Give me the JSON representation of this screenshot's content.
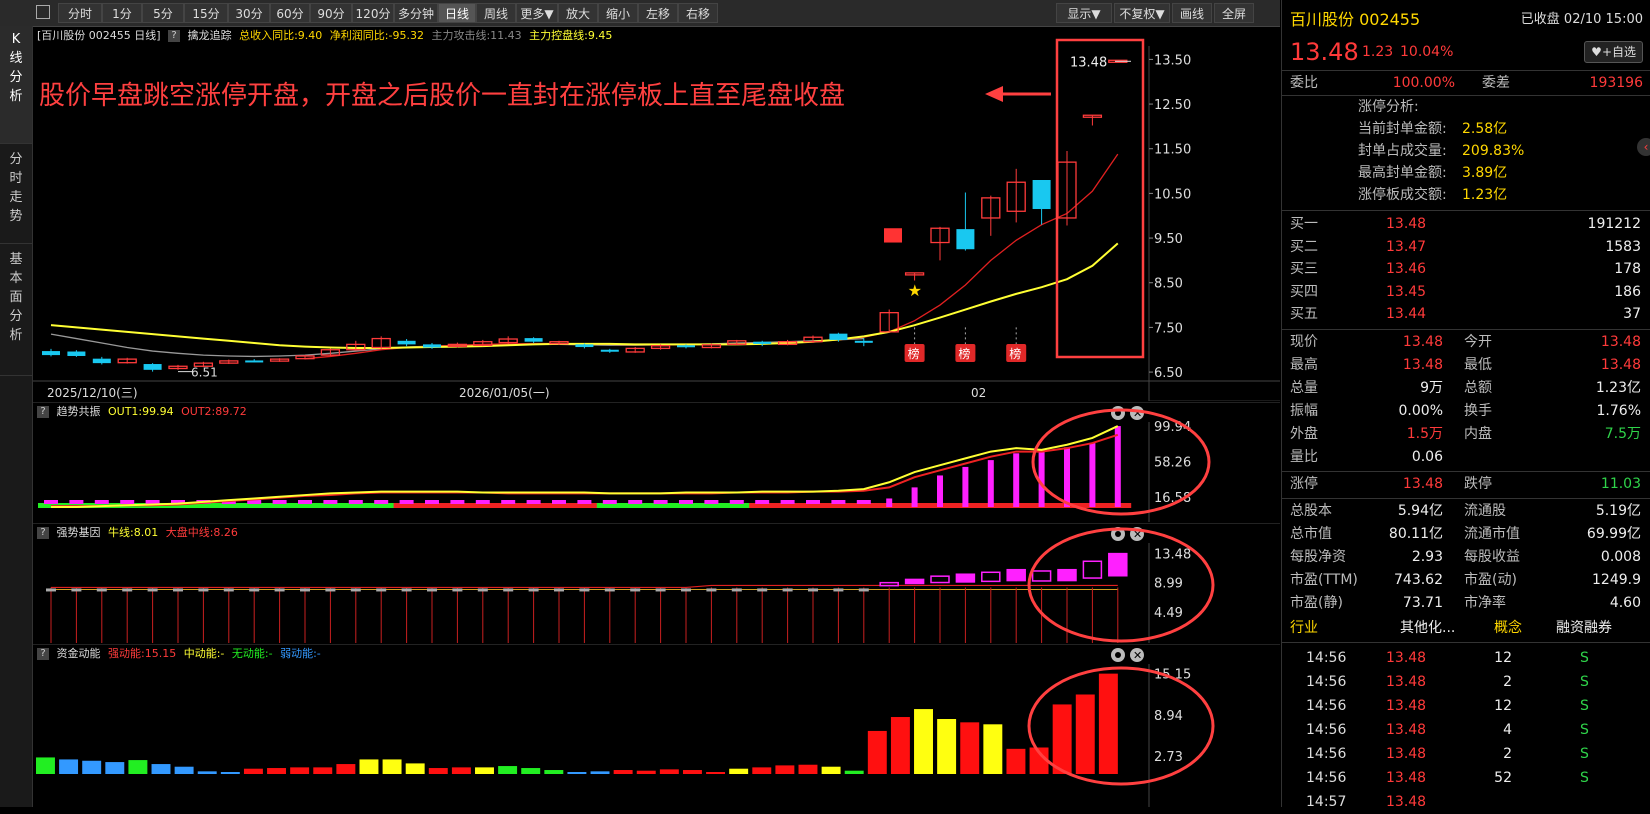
{
  "toolbar": {
    "left_items": [
      "分时",
      "1分",
      "5分",
      "15分",
      "30分",
      "60分",
      "90分",
      "120分",
      "多分钟",
      "日线",
      "周线",
      "更多▼",
      "放大",
      "缩小",
      "左移",
      "右移"
    ],
    "active_index": 9,
    "right_items": [
      "显示▼",
      "不复权▼",
      "画线",
      "全屏"
    ]
  },
  "sidetabs": [
    {
      "label": [
        "K",
        "线",
        "分",
        "析"
      ]
    },
    {
      "label": [
        "分",
        "时",
        "走",
        "势"
      ]
    },
    {
      "label": [
        "基",
        "本",
        "面",
        "分",
        "析"
      ]
    }
  ],
  "main_header": {
    "stock": "[百川股份 002455 日线]",
    "indicator": "擒龙追踪",
    "income": "总收入同比:9.40",
    "profit": "净利润同比:-95.32",
    "attack": "主力攻击线:11.43",
    "control": "主力控盘线:9.45"
  },
  "annotation": "股价早盘跳空涨停开盘，开盘之后股价一直封在涨停板上直至尾盘收盘",
  "last_price_label": "13.48",
  "low_label": "6.51",
  "rank_badge": "榜",
  "colors": {
    "up": "#ff3b3b",
    "down": "#19c8f0",
    "ma1": "#ffff33",
    "ma2": "#e02020",
    "ma3": "#999999",
    "annot": "#ff4040",
    "magenta": "#ff20ff",
    "green": "#22ee22",
    "blue": "#3399ff"
  },
  "x_labels": [
    "2025/12/10(三)",
    "2026/01/05(一)",
    "02"
  ],
  "chart_data": [
    {
      "type": "candlestick",
      "title": "百川股份 002455 日线",
      "y_ticks": [
        "13.50",
        "12.50",
        "11.50",
        "10.50",
        "9.50",
        "8.50",
        "7.50",
        "6.50"
      ],
      "ylim": [
        6.3,
        13.8
      ],
      "candles": [
        [
          6.97,
          6.88,
          7.02,
          6.85
        ],
        [
          6.96,
          6.86,
          6.99,
          6.84
        ],
        [
          6.8,
          6.7,
          6.84,
          6.67
        ],
        [
          6.71,
          6.79,
          6.82,
          6.69
        ],
        [
          6.68,
          6.55,
          6.7,
          6.51
        ],
        [
          6.58,
          6.63,
          6.66,
          6.55
        ],
        [
          6.63,
          6.7,
          6.73,
          6.61
        ],
        [
          6.7,
          6.75,
          6.78,
          6.68
        ],
        [
          6.76,
          6.74,
          6.79,
          6.72
        ],
        [
          6.75,
          6.79,
          6.81,
          6.73
        ],
        [
          6.8,
          6.86,
          6.88,
          6.78
        ],
        [
          6.88,
          7.0,
          7.03,
          6.86
        ],
        [
          7.0,
          7.12,
          7.2,
          6.98
        ],
        [
          7.05,
          7.25,
          7.3,
          7.02
        ],
        [
          7.2,
          7.12,
          7.24,
          7.08
        ],
        [
          7.12,
          7.05,
          7.15,
          7.02
        ],
        [
          7.08,
          7.12,
          7.16,
          7.05
        ],
        [
          7.1,
          7.18,
          7.22,
          7.08
        ],
        [
          7.16,
          7.24,
          7.3,
          7.13
        ],
        [
          7.26,
          7.18,
          7.28,
          7.15
        ],
        [
          7.14,
          7.18,
          7.2,
          7.11
        ],
        [
          7.12,
          7.06,
          7.14,
          7.03
        ],
        [
          7.0,
          6.96,
          7.02,
          6.93
        ],
        [
          6.95,
          7.03,
          7.06,
          6.93
        ],
        [
          7.03,
          7.09,
          7.12,
          7.0
        ],
        [
          7.1,
          7.07,
          7.12,
          7.03
        ],
        [
          7.05,
          7.11,
          7.14,
          7.03
        ],
        [
          7.12,
          7.2,
          7.22,
          7.1
        ],
        [
          7.18,
          7.13,
          7.2,
          7.08
        ],
        [
          7.12,
          7.18,
          7.22,
          7.1
        ],
        [
          7.18,
          7.28,
          7.32,
          7.15
        ],
        [
          7.36,
          7.22,
          7.38,
          7.18
        ],
        [
          7.2,
          7.18,
          7.26,
          7.08
        ],
        [
          7.4,
          7.83,
          7.9,
          7.38
        ],
        [
          8.72,
          8.72,
          8.72,
          8.55
        ],
        [
          9.4,
          9.72,
          9.75,
          9.0
        ],
        [
          9.7,
          9.25,
          10.52,
          9.22
        ],
        [
          9.95,
          10.4,
          10.45,
          9.55
        ],
        [
          10.1,
          10.75,
          11.05,
          9.85
        ],
        [
          10.8,
          10.15,
          10.8,
          9.8
        ],
        [
          9.95,
          11.2,
          11.45,
          9.78
        ],
        [
          12.25,
          12.25,
          12.25,
          12.02
        ],
        [
          13.48,
          13.48,
          13.48,
          13.48
        ]
      ],
      "ma_yellow": [
        7.55,
        7.5,
        7.45,
        7.4,
        7.35,
        7.3,
        7.25,
        7.2,
        7.15,
        7.1,
        7.07,
        7.05,
        7.04,
        7.04,
        7.05,
        7.06,
        7.07,
        7.08,
        7.1,
        7.12,
        7.13,
        7.13,
        7.13,
        7.12,
        7.12,
        7.12,
        7.12,
        7.12,
        7.13,
        7.15,
        7.18,
        7.23,
        7.3,
        7.4,
        7.55,
        7.72,
        7.9,
        8.08,
        8.25,
        8.4,
        8.58,
        8.88,
        9.38
      ],
      "ma_red": [
        null,
        null,
        null,
        null,
        null,
        null,
        null,
        null,
        null,
        null,
        6.8,
        6.85,
        6.92,
        7.0,
        7.05,
        7.08,
        7.1,
        7.12,
        7.13,
        7.14,
        7.14,
        7.13,
        7.12,
        7.11,
        7.11,
        7.11,
        7.12,
        7.13,
        7.14,
        7.16,
        7.18,
        7.22,
        7.28,
        7.4,
        7.65,
        8.0,
        8.45,
        9.0,
        9.45,
        9.8,
        10.05,
        10.55,
        11.38
      ],
      "ma_grey": [
        7.35,
        7.25,
        7.15,
        7.05,
        6.97,
        6.92,
        6.88,
        6.86,
        6.85,
        6.86,
        6.88,
        6.92,
        6.97,
        7.02,
        7.06,
        7.08,
        7.1,
        7.11,
        7.12,
        7.13,
        7.12,
        7.11,
        7.1,
        7.1,
        7.11,
        7.12,
        7.13,
        7.15,
        7.16,
        7.18,
        7.2,
        7.22,
        7.25
      ]
    },
    {
      "type": "bar",
      "title": "趋势共振",
      "legend": [
        "OUT1:99.94",
        "OUT2:89.72"
      ],
      "y_ticks": [
        "99.94",
        "58.26",
        "16.58"
      ],
      "ylim": [
        5,
        100
      ],
      "bars": [
        0,
        0,
        0,
        0,
        0,
        0,
        0,
        0,
        0,
        0,
        0,
        0,
        0,
        0,
        0,
        0,
        0,
        0,
        0,
        0,
        0,
        0,
        0,
        0,
        0,
        0,
        0,
        0,
        0,
        0,
        0,
        0,
        0,
        15,
        28,
        42,
        52,
        60,
        68,
        72,
        75,
        80,
        99.94
      ],
      "bar_color_flag": [
        2,
        2,
        2,
        2,
        2,
        2,
        2,
        2,
        2,
        2,
        2,
        2,
        2,
        2,
        1,
        1,
        1,
        1,
        1,
        1,
        1,
        1,
        2,
        2,
        2,
        2,
        2,
        2,
        1,
        1,
        1,
        1,
        1,
        1,
        1,
        1,
        1,
        1,
        1,
        1,
        1,
        1,
        1
      ],
      "out1": [
        5,
        5,
        6,
        7,
        8,
        9,
        11,
        13,
        15,
        17,
        19,
        21,
        22,
        23,
        23,
        23,
        23,
        22,
        22,
        22,
        22,
        22,
        21,
        21,
        21,
        22,
        22,
        22,
        23,
        23,
        23,
        24,
        26,
        34,
        46,
        54,
        62,
        70,
        74,
        72,
        78,
        86,
        99.94
      ],
      "out2": [
        6,
        6,
        6,
        7,
        7,
        8,
        10,
        12,
        14,
        16,
        18,
        19,
        21,
        22,
        22,
        22,
        22,
        22,
        21,
        21,
        21,
        21,
        21,
        21,
        21,
        21,
        21,
        22,
        22,
        22,
        23,
        23,
        24,
        28,
        40,
        48,
        56,
        64,
        70,
        70,
        74,
        80,
        89.72
      ]
    },
    {
      "type": "bar",
      "title": "强势基因",
      "legend": [
        "牛线:8.01",
        "大盘中线:8.26"
      ],
      "y_ticks": [
        "13.48",
        "8.99",
        "4.49"
      ],
      "ylim": [
        0,
        14.5
      ]
    },
    {
      "type": "bar",
      "title": "资金动能",
      "legend": [
        "强动能:15.15",
        "中动能:-",
        "无动能:-",
        "弱动能:-"
      ],
      "y_ticks": [
        "15.15",
        "8.94",
        "2.73"
      ],
      "ylim": [
        0,
        16
      ],
      "values": [
        2.5,
        2.2,
        2.0,
        1.8,
        2.1,
        1.5,
        1.1,
        0.4,
        0.3,
        0.8,
        0.9,
        1.0,
        1.0,
        1.5,
        2.2,
        2.2,
        1.6,
        0.9,
        1.0,
        1.0,
        1.2,
        0.9,
        0.6,
        0.3,
        0.4,
        0.6,
        0.5,
        0.7,
        0.6,
        0.3,
        0.8,
        1.0,
        1.3,
        1.4,
        1.1,
        0.5,
        6.5,
        8.6,
        9.8,
        8.3,
        7.8,
        7.5,
        3.8,
        4.0,
        10.5,
        12.0,
        15.15
      ],
      "colors": [
        "g",
        "b",
        "b",
        "b",
        "g",
        "b",
        "b",
        "b",
        "b",
        "r",
        "r",
        "r",
        "r",
        "r",
        "y",
        "y",
        "y",
        "r",
        "r",
        "y",
        "g",
        "g",
        "g",
        "b",
        "b",
        "r",
        "r",
        "r",
        "r",
        "r",
        "y",
        "r",
        "r",
        "r",
        "y",
        "g",
        "r",
        "r",
        "y",
        "y",
        "r",
        "y",
        "r",
        "r",
        "r",
        "r",
        "r"
      ]
    }
  ],
  "quote": {
    "title": "百川股份 002455",
    "status": "已收盘 02/10 15:00",
    "price": "13.48",
    "change": "1.23",
    "pct": "10.04%",
    "watch_btn": "+自选",
    "weibi_label": "委比",
    "weibi": "100.00%",
    "weicha_label": "委差",
    "weicha": "193196",
    "limit_title": "涨停分析:",
    "limit_rows": [
      {
        "label": "当前封单金额:",
        "value": "2.58亿"
      },
      {
        "label": "封单占成交量:",
        "value": "209.83%"
      },
      {
        "label": "最高封单金额:",
        "value": "3.89亿"
      },
      {
        "label": "涨停板成交额:",
        "value": "1.23亿"
      }
    ],
    "bids": [
      {
        "label": "买一",
        "price": "13.48",
        "vol": "191212"
      },
      {
        "label": "买二",
        "price": "13.47",
        "vol": "1583"
      },
      {
        "label": "买三",
        "price": "13.46",
        "vol": "178"
      },
      {
        "label": "买四",
        "price": "13.45",
        "vol": "186"
      },
      {
        "label": "买五",
        "price": "13.44",
        "vol": "37"
      }
    ],
    "stats1": [
      {
        "l1": "现价",
        "v1": "13.48",
        "c1": "red",
        "l2": "今开",
        "v2": "13.48",
        "c2": "red"
      },
      {
        "l1": "最高",
        "v1": "13.48",
        "c1": "red",
        "l2": "最低",
        "v2": "13.48",
        "c2": "red"
      },
      {
        "l1": "总量",
        "v1": "9万",
        "c1": "white",
        "l2": "总额",
        "v2": "1.23亿",
        "c2": "white"
      },
      {
        "l1": "振幅",
        "v1": "0.00%",
        "c1": "white",
        "l2": "换手",
        "v2": "1.76%",
        "c2": "white"
      },
      {
        "l1": "外盘",
        "v1": "1.5万",
        "c1": "red",
        "l2": "内盘",
        "v2": "7.5万",
        "c2": "green"
      },
      {
        "l1": "量比",
        "v1": "0.06",
        "c1": "white",
        "l2": "",
        "v2": "",
        "c2": "white"
      }
    ],
    "stats2": [
      {
        "l1": "涨停",
        "v1": "13.48",
        "c1": "red",
        "l2": "跌停",
        "v2": "11.03",
        "c2": "green"
      }
    ],
    "stats3": [
      {
        "l1": "总股本",
        "v1": "5.94亿",
        "c1": "white",
        "l2": "流通股",
        "v2": "5.19亿",
        "c2": "white"
      },
      {
        "l1": "总市值",
        "v1": "80.11亿",
        "c1": "white",
        "l2": "流通市值",
        "v2": "69.99亿",
        "c2": "white"
      },
      {
        "l1": "每股净资",
        "v1": "2.93",
        "c1": "white",
        "l2": "每股收益",
        "v2": "0.008",
        "c2": "white"
      },
      {
        "l1": "市盈(TTM)",
        "v1": "743.62",
        "c1": "white",
        "l2": "市盈(动)",
        "v2": "1249.9",
        "c2": "white"
      },
      {
        "l1": "市盈(静)",
        "v1": "73.71",
        "c1": "white",
        "l2": "市净率",
        "v2": "4.60",
        "c2": "white"
      }
    ],
    "industry": {
      "c1": "行业",
      "c2": "其他化...",
      "c3": "概念",
      "c4": "融资融券"
    },
    "ticks": [
      {
        "t": "14:56",
        "p": "13.48",
        "v": "12",
        "d": "S"
      },
      {
        "t": "14:56",
        "p": "13.48",
        "v": "2",
        "d": "S"
      },
      {
        "t": "14:56",
        "p": "13.48",
        "v": "12",
        "d": "S"
      },
      {
        "t": "14:56",
        "p": "13.48",
        "v": "4",
        "d": "S"
      },
      {
        "t": "14:56",
        "p": "13.48",
        "v": "2",
        "d": "S"
      },
      {
        "t": "14:56",
        "p": "13.48",
        "v": "52",
        "d": "S"
      },
      {
        "t": "14:57",
        "p": "13.48",
        "v": "",
        "d": ""
      }
    ]
  }
}
